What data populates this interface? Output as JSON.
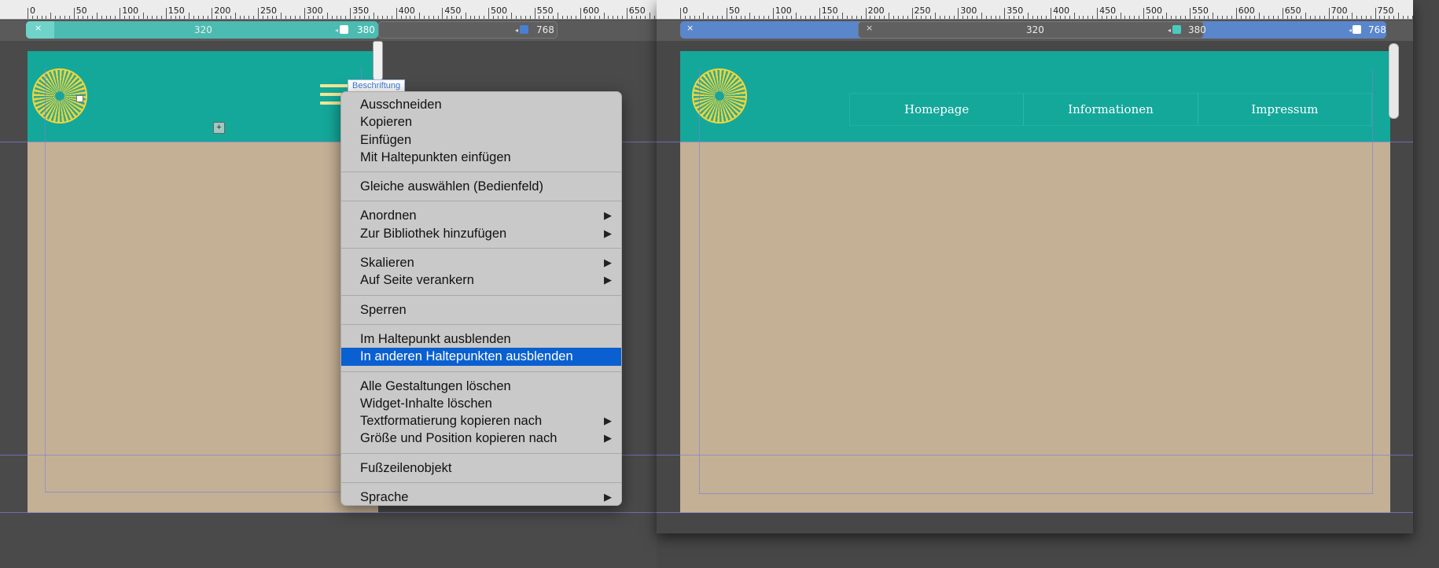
{
  "left_window": {
    "ruler": [
      "0",
      "50",
      "100",
      "150",
      "200",
      "250",
      "300",
      "350",
      "400",
      "450",
      "500",
      "550",
      "600",
      "650"
    ],
    "breakpoints": {
      "active_width": "320",
      "min": "380",
      "max": "768"
    },
    "element_tag": "Beschriftung",
    "add_symbol": "+",
    "colors": {
      "header": "#14a89a",
      "body": "#c4b095",
      "accent": "#4cbcb2"
    }
  },
  "context_menu": {
    "items": [
      {
        "label": "Ausschneiden"
      },
      {
        "label": "Kopieren"
      },
      {
        "label": "Einfügen"
      },
      {
        "label": "Mit Haltepunkten einfügen"
      },
      {
        "sep": true
      },
      {
        "label": "Gleiche auswählen (Bedienfeld)"
      },
      {
        "sep": true
      },
      {
        "label": "Anordnen",
        "sub": "▶"
      },
      {
        "label": "Zur Bibliothek hinzufügen",
        "sub": "▶"
      },
      {
        "sep": true
      },
      {
        "label": "Skalieren",
        "sub": "▶"
      },
      {
        "label": "Auf Seite verankern",
        "sub": "▶"
      },
      {
        "sep": true
      },
      {
        "label": "Sperren"
      },
      {
        "sep": true
      },
      {
        "label": "Im Haltepunkt ausblenden"
      },
      {
        "label": "In anderen Haltepunkten ausblenden",
        "highlight": true
      },
      {
        "sep": true
      },
      {
        "label": "Alle Gestaltungen löschen"
      },
      {
        "label": "Widget-Inhalte löschen"
      },
      {
        "label": "Textformatierung kopieren nach",
        "sub": "▶"
      },
      {
        "label": "Größe und Position kopieren nach",
        "sub": "▶"
      },
      {
        "sep": true
      },
      {
        "label": "Fußzeilenobjekt"
      },
      {
        "sep": true
      },
      {
        "label": "Sprache",
        "sub": "▶"
      }
    ]
  },
  "right_window": {
    "ruler": [
      "0",
      "50",
      "100",
      "150",
      "200",
      "250",
      "300",
      "350",
      "400",
      "450",
      "500",
      "550",
      "600",
      "650",
      "700",
      "750"
    ],
    "breakpoints": {
      "small": "320",
      "mid": "380",
      "max": "768"
    },
    "nav": [
      "Homepage",
      "Informationen",
      "Impressum"
    ],
    "colors": {
      "header": "#14a89a",
      "body": "#c4b095",
      "bp_bar": "#5a86cc"
    }
  },
  "icons": {
    "close": "×",
    "arrow_left": "◂",
    "arrow_right": "▸"
  }
}
